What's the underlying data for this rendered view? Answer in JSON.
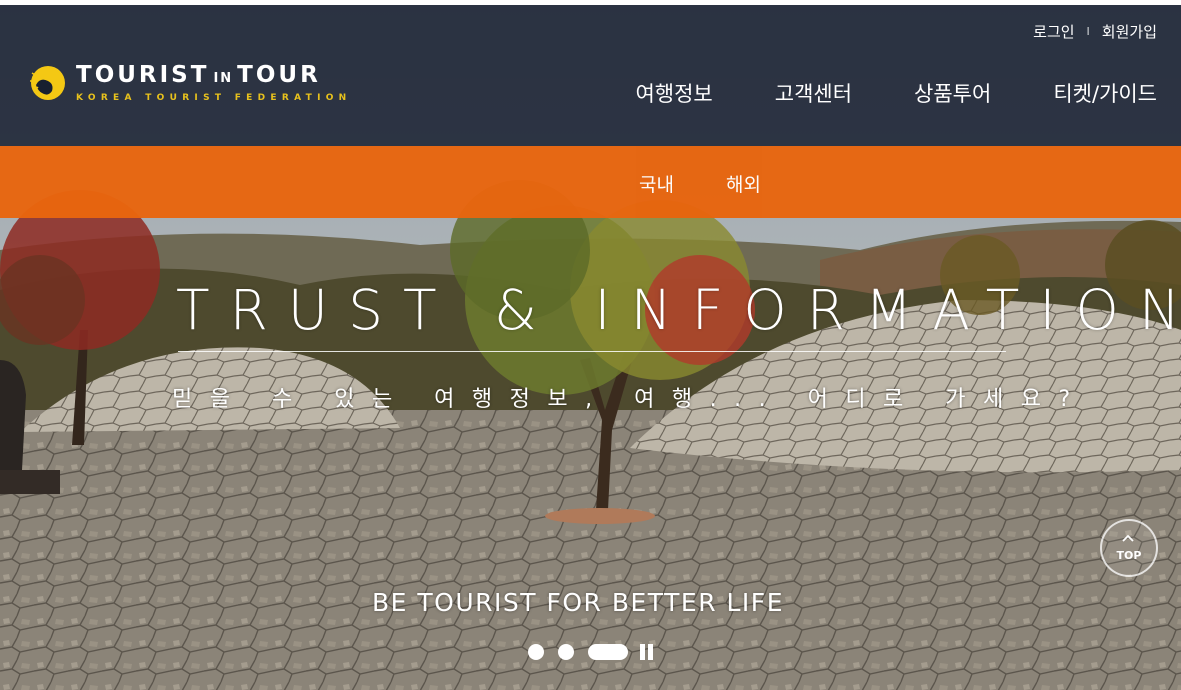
{
  "header": {
    "util_links": {
      "login": "로그인",
      "separator": "I",
      "signup": "회원가입"
    },
    "logo": {
      "part1": "TOURIST",
      "part2": "IN",
      "part3": "TOUR",
      "tagline": "KOREA TOURIST FEDERATION",
      "accent_color": "#e8c21c"
    },
    "main_nav": [
      "여행정보",
      "고객센터",
      "상품투어",
      "티켓/가이드"
    ]
  },
  "subnav": {
    "bar_color": "#e8650e",
    "items": [
      "국내",
      "해외"
    ]
  },
  "hero": {
    "headline": "TRUST & INFORMATION",
    "subline": "믿을 수 있는 여행정보, 여행... 어디로 가세요?",
    "tagline": "BE TOURIST FOR BETTER LIFE",
    "slides_total": 3,
    "active_slide": 3,
    "pause_icon": "pause-icon"
  },
  "top_button": {
    "label": "TOP",
    "icon": "chevron-up-icon"
  }
}
